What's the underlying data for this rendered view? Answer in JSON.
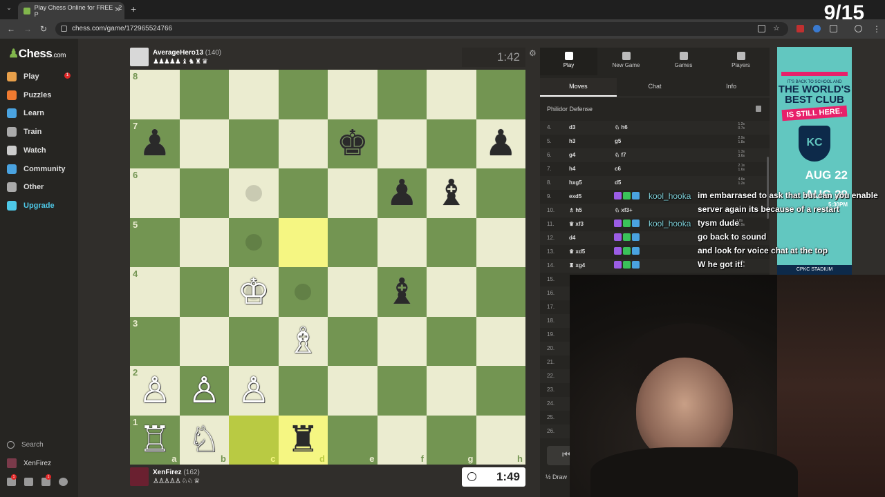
{
  "browser": {
    "tab_title": "Play Chess Online for FREE - 2 P",
    "url": "chess.com/game/172965524766",
    "overlay_counter": "9/15"
  },
  "sidebar": {
    "logo_text": "Chess",
    "logo_suffix": ".com",
    "items": [
      {
        "label": "Play",
        "icon": "pawn-icon",
        "color": "#e8a04a",
        "badge": "1"
      },
      {
        "label": "Puzzles",
        "icon": "puzzle-icon",
        "color": "#f07a30"
      },
      {
        "label": "Learn",
        "icon": "graduation-cap-icon",
        "color": "#4aa3e0"
      },
      {
        "label": "Train",
        "icon": "chess-piece-icon",
        "color": "#aaaaaa"
      },
      {
        "label": "Watch",
        "icon": "binoculars-icon",
        "color": "#cccccc"
      },
      {
        "label": "Community",
        "icon": "people-icon",
        "color": "#4aa3e0"
      },
      {
        "label": "Other",
        "icon": "more-dots-icon",
        "color": "#aaaaaa"
      },
      {
        "label": "Upgrade",
        "icon": "diamond-icon",
        "color": "#4ec9e8"
      }
    ],
    "search_label": "Search",
    "username": "XenFirez",
    "notif_badge": "1"
  },
  "top_player": {
    "name": "AverageHero13",
    "rating": "(140)",
    "captured": "♟♟♟♟♟ ♝ ♞ ♜ ♛",
    "clock": "1:42"
  },
  "bottom_player": {
    "name": "XenFirez",
    "rating": "(162)",
    "captured": "♙♙♙♙♙ ♘♘ ♕",
    "clock": "1:49"
  },
  "board": {
    "ranks": [
      "8",
      "7",
      "6",
      "5",
      "4",
      "3",
      "2",
      "1"
    ],
    "files": [
      "a",
      "b",
      "c",
      "d",
      "e",
      "f",
      "g",
      "h"
    ],
    "pieces": {
      "a7": "♟",
      "e7": "♚",
      "h7": "♟",
      "f6": "♟",
      "g6": "♝",
      "c4": "♔",
      "f4": "♝",
      "d3": "♗",
      "a2": "♙",
      "b2": "♙",
      "c2": "♙",
      "a1": "♖",
      "b1": "♘",
      "d1": "♜"
    },
    "white_pieces": [
      "c4",
      "d3",
      "a2",
      "b2",
      "c2",
      "a1",
      "b1"
    ],
    "highlights": [
      "d5",
      "c1",
      "d1"
    ],
    "move_dots": [
      "c6",
      "c5",
      "c4",
      "d4"
    ]
  },
  "panel": {
    "top_tabs": [
      {
        "label": "Play",
        "icon": "lightning-icon"
      },
      {
        "label": "New Game",
        "icon": "plus-icon"
      },
      {
        "label": "Games",
        "icon": "grid-icon"
      },
      {
        "label": "Players",
        "icon": "players-icon"
      }
    ],
    "sub_tabs": [
      "Moves",
      "Chat",
      "Info"
    ],
    "opening": "Philidor Defense",
    "moves": [
      {
        "n": "4.",
        "w": "d3",
        "b": "♘ h6",
        "t": "1.2s\n0.7s"
      },
      {
        "n": "5.",
        "w": "h3",
        "b": "g5",
        "t": "2.9s\n1.8s"
      },
      {
        "n": "6.",
        "w": "g4",
        "b": "♘ f7",
        "t": "1.3s\n3.6s"
      },
      {
        "n": "7.",
        "w": "h4",
        "b": "c6",
        "t": "2.1s\n1.6s"
      },
      {
        "n": "8.",
        "w": "hxg5",
        "b": "d5",
        "t": "4.6s\n1.2s"
      },
      {
        "n": "9.",
        "w": "exd5",
        "b": "",
        "t": ""
      },
      {
        "n": "10.",
        "w": "♗ h5",
        "b": "♘ xf3+",
        "t": ""
      },
      {
        "n": "11.",
        "w": "♛ xf3",
        "b": "",
        "t": "1.8s\n10.9s"
      },
      {
        "n": "12.",
        "w": "d4",
        "b": "",
        "t": ""
      },
      {
        "n": "13.",
        "w": "♛ xd5",
        "b": "",
        "t": ""
      },
      {
        "n": "14.",
        "w": "♜ xg4",
        "b": "",
        "t": "1.8s\n1.5s"
      },
      {
        "n": "15.",
        "w": "",
        "b": "",
        "t": ""
      },
      {
        "n": "16.",
        "w": "",
        "b": "",
        "t": ""
      },
      {
        "n": "17.",
        "w": "",
        "b": "",
        "t": ""
      },
      {
        "n": "18.",
        "w": "",
        "b": "",
        "t": ""
      },
      {
        "n": "19.",
        "w": "",
        "b": "",
        "t": ""
      },
      {
        "n": "20.",
        "w": "",
        "b": "",
        "t": ""
      },
      {
        "n": "21.",
        "w": "",
        "b": "",
        "t": ""
      },
      {
        "n": "22.",
        "w": "",
        "b": "",
        "t": ""
      },
      {
        "n": "23.",
        "w": "",
        "b": "",
        "t": ""
      },
      {
        "n": "24.",
        "w": "",
        "b": "",
        "t": ""
      },
      {
        "n": "25.",
        "w": "",
        "b": "",
        "t": ""
      },
      {
        "n": "26.",
        "w": "",
        "b": "",
        "t": ""
      }
    ],
    "draw_label": "½ Draw"
  },
  "ad": {
    "tagline": "IT'S BACK TO SCHOOL AND",
    "headline": "THE WORLD'S BEST CLUB",
    "banner": "IS STILL HERE.",
    "crest": "KC",
    "date1": "AUG 22",
    "date2": "AUG 29",
    "time": "5:30PM",
    "stadium": "CPKC STADIUM"
  },
  "chat_overlay": [
    {
      "name": "kool_hooka",
      "name_color": "#7fd0d8",
      "msg": "im embarrased to ask that but can you enable"
    },
    {
      "name": "",
      "name_color": "#7fd0d8",
      "msg": "server again its because of a restart"
    },
    {
      "name": "kool_hooka",
      "name_color": "#7fd0d8",
      "msg": "tysm dude"
    },
    {
      "name": "",
      "name_color": "#6a5cff",
      "msg": "go back to sound"
    },
    {
      "name": "",
      "name_color": "#6a5cff",
      "msg": "and look for voice chat at the top"
    },
    {
      "name": "",
      "name_color": "#6a5cff",
      "msg": "W he got it!"
    }
  ],
  "colors": {
    "light_square": "#ebecd0",
    "dark_square": "#739552",
    "highlight": "#f5f682",
    "accent": "#81b64c"
  }
}
